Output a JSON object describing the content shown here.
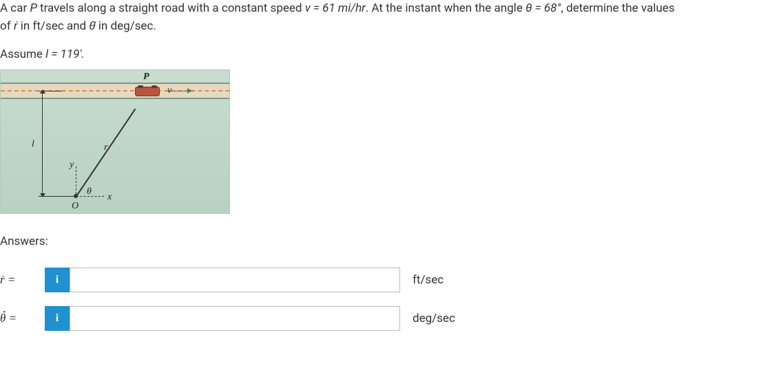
{
  "problem": {
    "line1_pre": "A car ",
    "car_var": "P",
    "line1_mid": " travels along a straight road with a constant speed ",
    "v_eq": "v = 61 mi/hr",
    "line1_post": ". At the instant when the angle ",
    "theta_eq": "θ = 68°",
    "line1_end": ", determine the values",
    "line2_pre": "of ",
    "rdot": "ṙ",
    "line2_mid": " in ft/sec and ",
    "thetadot": "θ̇",
    "line2_end": " in deg/sec."
  },
  "assume": {
    "pre": "Assume ",
    "l_eq": "l = 119'."
  },
  "diagram": {
    "P": "P",
    "v": "v",
    "O": "O",
    "x": "x",
    "y": "y",
    "theta": "θ",
    "r": "r",
    "l": "l"
  },
  "answers": {
    "heading": "Answers:",
    "rdot_label": "ṙ  =",
    "thetadot_label_theta": "θ",
    "thetadot_label_eq": "  =",
    "info": "i",
    "unit_rdot": "ft/sec",
    "unit_thetadot": "deg/sec"
  }
}
